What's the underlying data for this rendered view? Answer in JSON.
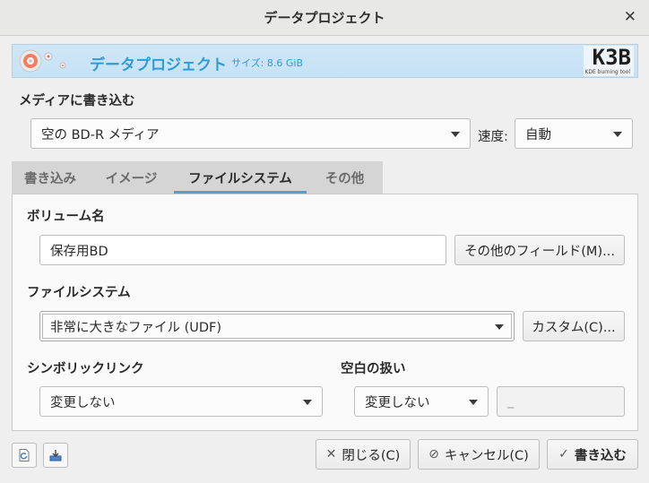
{
  "window": {
    "title": "データプロジェクト"
  },
  "banner": {
    "project_title": "データプロジェクト",
    "size_text": "サイズ: 8.6 GiB",
    "logo_text": "K3B",
    "logo_tagline": "KDE burning tool"
  },
  "burn_media": {
    "heading": "メディアに書き込む",
    "media_value": "空の BD-R メディア",
    "speed_label": "速度:",
    "speed_value": "自動"
  },
  "tabs": [
    {
      "label": "書き込み"
    },
    {
      "label": "イメージ"
    },
    {
      "label": "ファイルシステム"
    },
    {
      "label": "その他"
    }
  ],
  "active_tab": "ファイルシステム",
  "filesystem_tab": {
    "volume_name_heading": "ボリューム名",
    "volume_name_value": "保存用BD",
    "more_fields_button": "その他のフィールド(M)...",
    "filesystem_heading": "ファイルシステム",
    "filesystem_value": "非常に大きなファイル (UDF)",
    "custom_button": "カスタム(C)...",
    "symlink_heading": "シンボリックリンク",
    "symlink_value": "変更しない",
    "whitespace_heading": "空白の扱い",
    "whitespace_value": "変更しない",
    "whitespace_replace_value": "_"
  },
  "footer": {
    "close_button": "閉じる(C)",
    "cancel_button": "キャンセル(C)",
    "burn_button": "書き込む"
  },
  "colors": {
    "accent": "#4ca3dc",
    "banner_text": "#2f9bd9",
    "banner_bg": "#c8e3f6"
  }
}
